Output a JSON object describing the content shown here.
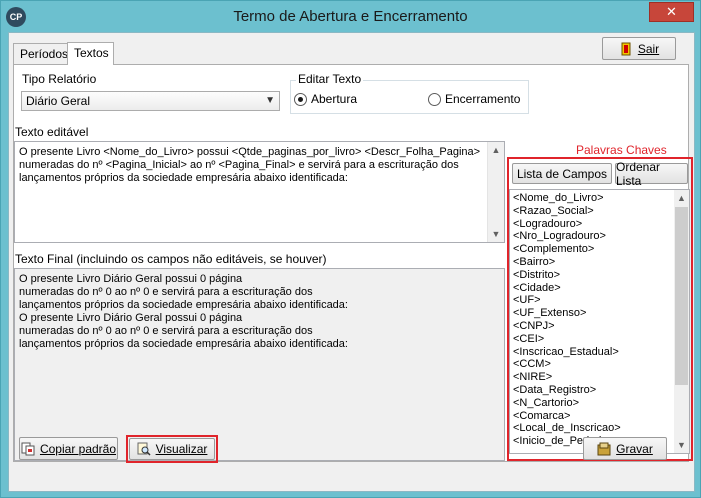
{
  "window": {
    "title": "Termo de Abertura e Encerramento",
    "app_icon": "CP",
    "close_glyph": "✕"
  },
  "tabs": [
    {
      "label": "Períodos",
      "active": false
    },
    {
      "label": "Textos",
      "active": true
    }
  ],
  "header": {
    "exit_label": "Sair",
    "exit_icon": "exit-door-icon"
  },
  "tipo_relatorio": {
    "label": "Tipo Relatório",
    "selected": "Diário Geral"
  },
  "editar_texto": {
    "label": "Editar Texto",
    "options": [
      {
        "label": "Abertura",
        "checked": true
      },
      {
        "label": "Encerramento",
        "checked": false
      }
    ]
  },
  "texto_editavel": {
    "label": "Texto editável",
    "lines": [
      "O presente Livro <Nome_do_Livro> possui <Qtde_paginas_por_livro> <Descr_Folha_Pagina>",
      "numeradas do nº <Pagina_Inicial> ao nº <Pagina_Final> e servirá para a escrituração dos",
      "lançamentos próprios da sociedade empresária abaixo identificada:"
    ]
  },
  "texto_final": {
    "label": "Texto Final (incluindo os campos não editáveis, se houver)",
    "lines": [
      "O presente Livro Diário Geral possui 0 página",
      "numeradas do nº 0 ao nº 0 e servirá para a escrituração dos",
      "lançamentos próprios da sociedade empresária abaixo identificada:",
      "O presente Livro Diário Geral possui 0 página",
      "numeradas do nº 0 ao nº 0 e servirá para a escrituração dos",
      "lançamentos próprios da sociedade empresária abaixo identificada:"
    ]
  },
  "palavras_chaves": {
    "title": "Palavras Chaves",
    "lista_campos_label": "Lista de Campos",
    "ordenar_lista_label": "Ordenar Lista",
    "items": [
      "<Nome_do_Livro>",
      "<Razao_Social>",
      "<Logradouro>",
      "<Nro_Logradouro>",
      "<Complemento>",
      "<Bairro>",
      "<Distrito>",
      "<Cidade>",
      "<UF>",
      "<UF_Extenso>",
      "<CNPJ>",
      "<CEI>",
      "<Inscricao_Estadual>",
      "<CCM>",
      "<NIRE>",
      "<Data_Registro>",
      "<N_Cartorio>",
      "<Comarca>",
      "<Local_de_Inscricao>",
      "<Inicio_de_Periodo>"
    ]
  },
  "footer": {
    "copiar_label": "Copiar padrão",
    "visualizar_label": "Visualizar",
    "gravar_label": "Gravar"
  },
  "colors": {
    "highlight": "#e0242b",
    "titlebar": "#6cc0cf"
  }
}
